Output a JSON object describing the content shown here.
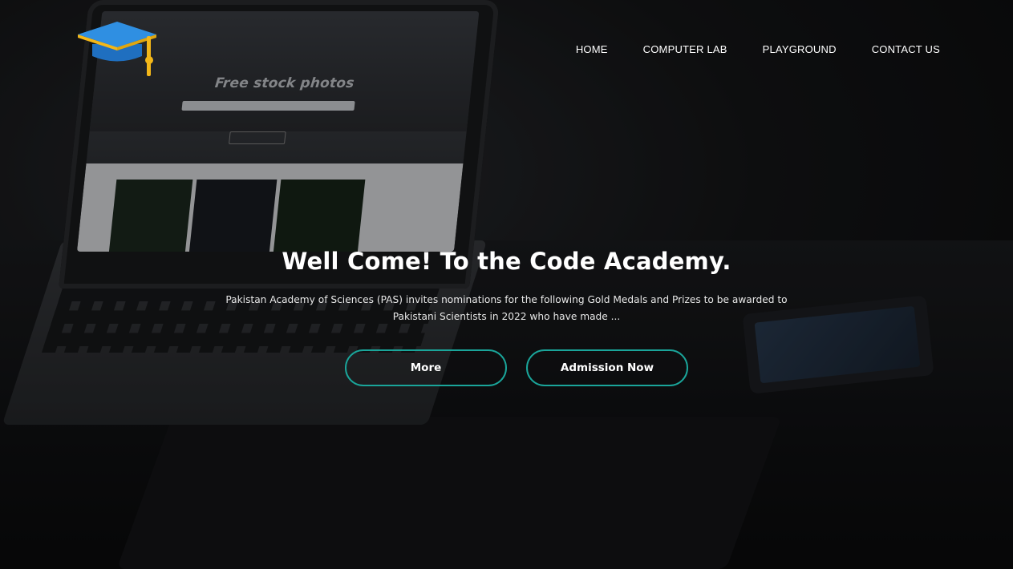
{
  "brand": {
    "logo_icon": "graduation-cap-icon",
    "colors": {
      "cap": "#2b84d8",
      "tassel": "#f3b719"
    }
  },
  "nav": {
    "items": [
      {
        "label": "HOME"
      },
      {
        "label": "COMPUTER LAB"
      },
      {
        "label": "PLAYGROUND"
      },
      {
        "label": "CONTACT US"
      }
    ]
  },
  "hero": {
    "title": "Well Come! To the Code Academy.",
    "line1": "Pakistan Academy of Sciences (PAS) invites nominations for the following Gold Medals and Prizes to be awarded to",
    "line2": "Pakistani Scientists in 2022 who have made ...",
    "buttons": {
      "more": "More",
      "admission": "Admission Now"
    },
    "button_border_color": "#1aa59a"
  },
  "background": {
    "laptop_screen_title": "Free stock photos"
  }
}
